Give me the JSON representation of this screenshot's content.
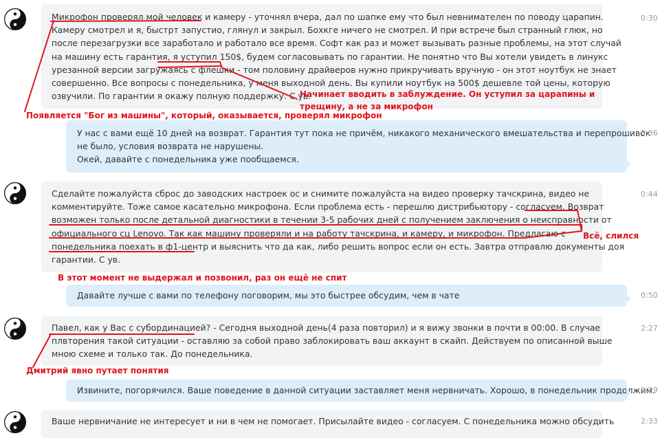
{
  "messages": [
    {
      "direction": "in",
      "time": "0:30",
      "lines": [
        "Микрофон проверял мой человек и камеру - уточнял вчера, дал по шапке ему что был невнимателен по поводу царапин.",
        "Камеру смотрел и я, быстрт запустио, глянул и закрыл. Бохкге ничего не смотрел. И при встрече был странный глюк, но",
        "после перезагрузки все заработало и работало все время. Софт как раз и может вызывать разные проблемы, на этот случай",
        "на машину есть гарантия, я уступил 150$, будем согласовывать по гарантии. Не понятно что Вы хотели увидеть в линукс",
        "урезанной версии загружаясь с флешки - том половину драйверов нужно прикручивать вручную - он этот ноутбук не знает",
        "совершенно. Все вопросы с понедельника, у меня выходной день. Вы купили ноутбук на 500$ дешевле той цены, которую",
        "озвучили. По гарантии я окажу полную поддержку. С ув."
      ]
    },
    {
      "direction": "out",
      "time": "0:36",
      "lines": [
        "У нас с вами ещё 10 дней на возврат. Гарантия тут пока не причём, никакого механического вмешательства и перепрошивок",
        "не было, условия возврата не нарушены.",
        "Окей, давайте с понедельника уже пообщаемся."
      ]
    },
    {
      "direction": "in",
      "time": "0:44",
      "lines": [
        "Сделайте пожалуйста сброс до заводских настроек ос и снимите пожалуйста  на видео проверку тачскрина, видео не",
        "комментируйте. Тоже самое касательно микрофона. Если проблема есть - перешлю дистрибьютору - согласуем. Возврат",
        "возможен только после детальной диагностики в течении 3-5 рабочих дней с получением заключения о неисправности от",
        "официального сц Lenovo. Так как машину проверяли и на работу тачскрина, и камеру, и микрофон. Предлагаю с",
        "понедельника поехать в ф1-центр и выяснить что да как, либо решить вопрос если он есть. Завтра отправлю документы доя",
        "гарантии. С ув."
      ]
    },
    {
      "direction": "out",
      "time": "0:50",
      "lines": [
        "Давайте лучше с вами по телефону поговорим, мы это быстрее обсудим, чем в чате"
      ]
    },
    {
      "direction": "in",
      "time": "2:27",
      "lines": [
        "Павел, как у Вас с субординацией? - Сегодня выходной день(4 раза повторил) и я вижу звонки в почти в 00:00. В случае",
        "плвторения такой ситуации - оставляю за собой право заблокировать ваш аккаунт в скайп. Действуем по описанной выше",
        "мною схеме и только так. До понедельника."
      ]
    },
    {
      "direction": "out",
      "time": "2:29",
      "lines": [
        "Извините, погорячился. Ваше поведение в данной ситуации заставляет меня нервничать. Хорошо, в понедельник продолжим."
      ]
    },
    {
      "direction": "in",
      "time": "2:33",
      "lines": [
        "Ваше нервничание не интересует и ни в чем не помогает. Присылайте видео - согласуем.  С понедельника можно обсудить"
      ]
    }
  ],
  "annotations": [
    "Начинает вводить в заблуждение. Он уступил за царапины и",
    "трещину, а не за микрофон",
    "Появляется \"Бог из машины\", который, оказывается, проверял микрофон",
    "Всё, слился",
    "В этот момент не выдержал и позвонил, раз он ещё не спит",
    "Дмитрий явно путает понятия"
  ],
  "colors": {
    "annotation_red": "#e0151c",
    "incoming_bubble": "#f1f3f5",
    "outgoing_bubble": "#ddeefa",
    "timestamp": "#9a9a9a"
  }
}
